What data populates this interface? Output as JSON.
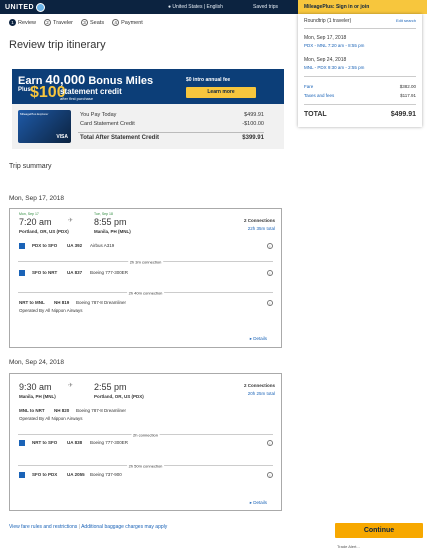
{
  "header": {
    "logo": "UNITED",
    "country": "United States | English",
    "saved_trips": "Saved trips",
    "mileageplus": "MileagePlus: Sign in or join"
  },
  "steps": [
    {
      "num": "1",
      "label": "Review"
    },
    {
      "num": "2",
      "label": "Traveler"
    },
    {
      "num": "3",
      "label": "Seats"
    },
    {
      "num": "4",
      "label": "Payment"
    }
  ],
  "page_title": "Review trip itinerary",
  "promo": {
    "earn_prefix": "Earn ",
    "miles_number": "40,000",
    "earn_suffix": " Bonus Miles",
    "plus": "Plus",
    "hundred": "$100",
    "statement_credit": "statement credit",
    "after_first": "after first purchase",
    "intro_fee": "$0 intro annual fee",
    "learn_more": "Learn more",
    "card_name": "MileagePlus Explorer",
    "card_network": "VISA",
    "you_pay_label": "You Pay Today",
    "you_pay_value": "$499.91",
    "credit_label": "Card Statement Credit",
    "credit_value": "-$100.00",
    "total_label": "Total After Statement Credit",
    "total_value": "$399.91"
  },
  "summary": {
    "trip_type": "Roundtrip (1 traveler)",
    "edit": "Edit search",
    "leg1_date": "Mon, Sep 17, 2018",
    "leg1_info": "PDX - MNL 7:20 am - 8:55 pm",
    "leg2_date": "Mon, Sep 24, 2018",
    "leg2_info": "MNL - PDX 9:30 am - 2:55 pm",
    "fare_label": "Fare",
    "fare_value": "$382.00",
    "taxes_label": "Taxes and fees",
    "taxes_value": "$117.91",
    "total_label": "TOTAL",
    "total_value": "$499.91"
  },
  "trip_summary_label": "Trip summary",
  "flights": [
    {
      "date_header": "Mon, Sep 17, 2018",
      "dep_date": "Mon, Sep 17",
      "dep_time": "7:20 am",
      "dep_city": "Portland, OR, US (PDX)",
      "arr_date": "Tue, Sep 18",
      "arr_time": "8:55 pm",
      "arr_city": "Manila, PH (MNL)",
      "connections": "2 Connections",
      "duration": "22h 35m total",
      "segments": [
        {
          "route": "PDX to SFO",
          "flight": "UA 392",
          "aircraft": "Airbus A319",
          "layover": "2h 3m connection",
          "operated": ""
        },
        {
          "route": "SFO to NRT",
          "flight": "UA 837",
          "aircraft": "Boeing 777-300ER",
          "layover": "2h 40m connection",
          "operated": ""
        },
        {
          "route": "NRT to MNL",
          "flight": "NH 819",
          "aircraft": "Boeing 787-8 Dreamliner",
          "layover": "",
          "operated": "Operated By All Nippon Airways"
        }
      ],
      "details": "Details"
    },
    {
      "date_header": "Mon, Sep 24, 2018",
      "dep_time": "9:30 am",
      "dep_city": "Manila, PH (MNL)",
      "arr_time": "2:55 pm",
      "arr_city": "Portland, OR, US (PDX)",
      "connections": "2 Connections",
      "duration": "20h 25m total",
      "segments": [
        {
          "route": "MNL to NRT",
          "flight": "NH 820",
          "aircraft": "Boeing 787-8 Dreamliner",
          "layover": "2h connection",
          "operated": "Operated By All Nippon Airways"
        },
        {
          "route": "NRT to SFO",
          "flight": "UA 838",
          "aircraft": "Boeing 777-300ER",
          "layover": "2h 50m connection",
          "operated": ""
        },
        {
          "route": "SFO to PDX",
          "flight": "UA 2055",
          "aircraft": "Boeing 737-900",
          "layover": "",
          "operated": ""
        }
      ],
      "details": "Details"
    }
  ],
  "footer": {
    "fare_rules": "View fare rules and restrictions",
    "baggage": "Additional baggage charges may apply",
    "continue": "Continue",
    "tad": "Trade Alert..."
  },
  "colors": {
    "navy": "#0c2340",
    "accent_blue": "#1a63b7",
    "gold": "#f7a800"
  }
}
